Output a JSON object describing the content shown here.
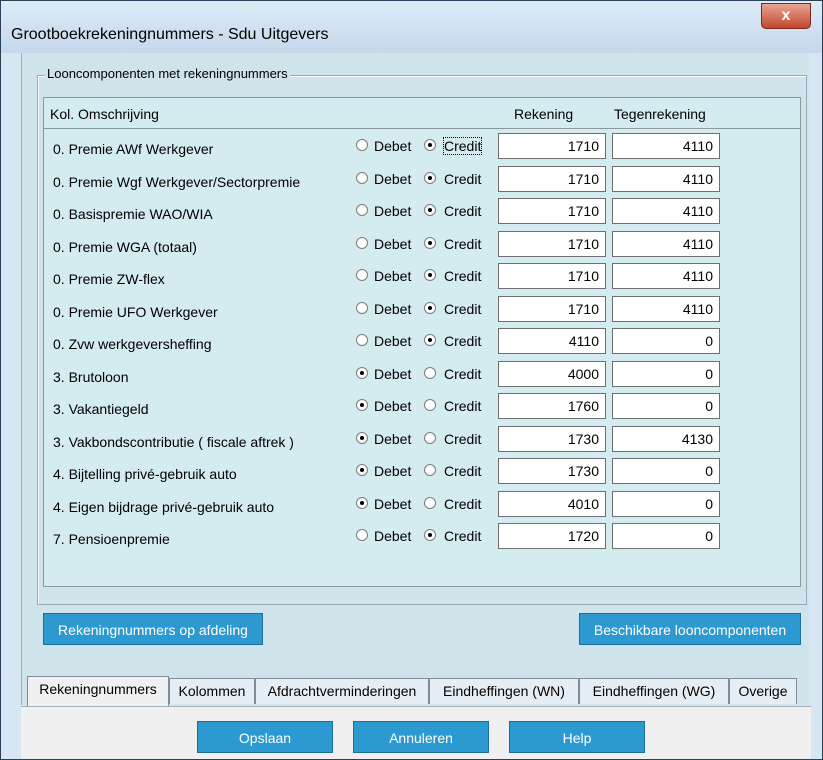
{
  "window": {
    "title": "Grootboekrekeningnummers - Sdu Uitgevers",
    "close_label": "x"
  },
  "group": {
    "legend": "Looncomponenten met rekeningnummers"
  },
  "headers": {
    "kol_omschrijving": "Kol. Omschrijving",
    "rekening": "Rekening",
    "tegenrekening": "Tegenrekening"
  },
  "labels": {
    "debet": "Debet",
    "credit": "Credit"
  },
  "rows": [
    {
      "description": "0. Premie AWf Werkgever",
      "selected": "credit",
      "rekening": "1710",
      "tegenrekening": "4110"
    },
    {
      "description": "0. Premie Wgf Werkgever/Sectorpremie",
      "selected": "credit",
      "rekening": "1710",
      "tegenrekening": "4110"
    },
    {
      "description": "0. Basispremie WAO/WIA",
      "selected": "credit",
      "rekening": "1710",
      "tegenrekening": "4110"
    },
    {
      "description": "0. Premie WGA (totaal)",
      "selected": "credit",
      "rekening": "1710",
      "tegenrekening": "4110"
    },
    {
      "description": "0. Premie ZW-flex",
      "selected": "credit",
      "rekening": "1710",
      "tegenrekening": "4110"
    },
    {
      "description": "0. Premie UFO Werkgever",
      "selected": "credit",
      "rekening": "1710",
      "tegenrekening": "4110"
    },
    {
      "description": "0. Zvw werkgeversheffing",
      "selected": "credit",
      "rekening": "4110",
      "tegenrekening": "0"
    },
    {
      "description": "3. Brutoloon",
      "selected": "debet",
      "rekening": "4000",
      "tegenrekening": "0"
    },
    {
      "description": "3. Vakantiegeld",
      "selected": "debet",
      "rekening": "1760",
      "tegenrekening": "0"
    },
    {
      "description": "3. Vakbondscontributie ( fiscale aftrek )",
      "selected": "debet",
      "rekening": "1730",
      "tegenrekening": "4130"
    },
    {
      "description": "4. Bijtelling privé-gebruik auto",
      "selected": "debet",
      "rekening": "1730",
      "tegenrekening": "0"
    },
    {
      "description": "4. Eigen bijdrage privé-gebruik auto",
      "selected": "debet",
      "rekening": "4010",
      "tegenrekening": "0"
    },
    {
      "description": "7. Pensioenpremie",
      "selected": "credit",
      "rekening": "1720",
      "tegenrekening": "0"
    }
  ],
  "buttons": {
    "rekeningnummers_op_afdeling": "Rekeningnummers op afdeling",
    "beschikbare_looncomponenten": "Beschikbare looncomponenten",
    "opslaan": "Opslaan",
    "annuleren": "Annuleren",
    "help": "Help"
  },
  "tabs": [
    {
      "label": "Rekeningnummers",
      "active": true
    },
    {
      "label": "Kolommen",
      "active": false
    },
    {
      "label": "Afdrachtverminderingen",
      "active": false
    },
    {
      "label": "Eindheffingen (WN)",
      "active": false
    },
    {
      "label": "Eindheffingen (WG)",
      "active": false
    },
    {
      "label": "Overige",
      "active": false
    }
  ]
}
